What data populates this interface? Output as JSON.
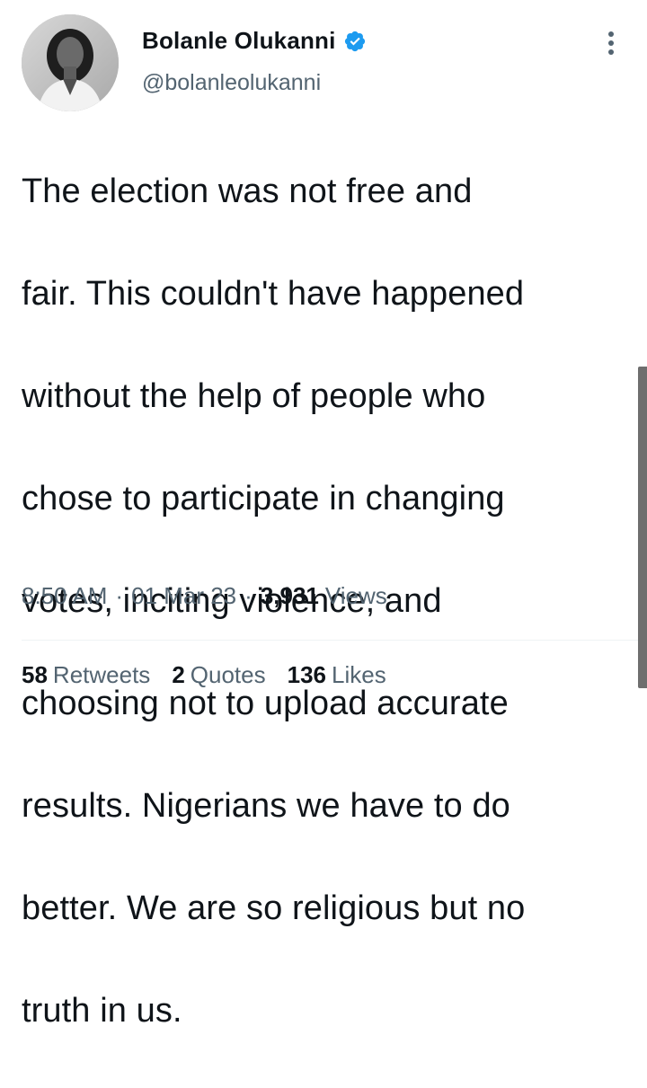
{
  "author": {
    "name": "Bolanle Olukanni",
    "handle": "@bolanleolukanni",
    "verified": true
  },
  "tweet": {
    "text_lines": [
      "The election was not free and",
      "fair. This couldn't have happened",
      "without the help of people who",
      "chose to participate in changing",
      "votes, inciting violence, and",
      "choosing not to upload accurate",
      "results. Nigerians we have to do",
      "better. We are so religious but no",
      "truth in us."
    ]
  },
  "meta": {
    "time": "8:50 AM",
    "separator": "·",
    "date": "01 Mar 23",
    "views_count": "3,931",
    "views_label": "Views"
  },
  "stats": {
    "retweets_count": "58",
    "retweets_label": "Retweets",
    "quotes_count": "2",
    "quotes_label": "Quotes",
    "likes_count": "136",
    "likes_label": "Likes"
  },
  "colors": {
    "verified_blue": "#1d9bf0",
    "secondary_text": "#536471",
    "primary_text": "#0f1419"
  },
  "icons": {
    "verified": "verified-badge-icon",
    "more": "more-options-icon"
  }
}
